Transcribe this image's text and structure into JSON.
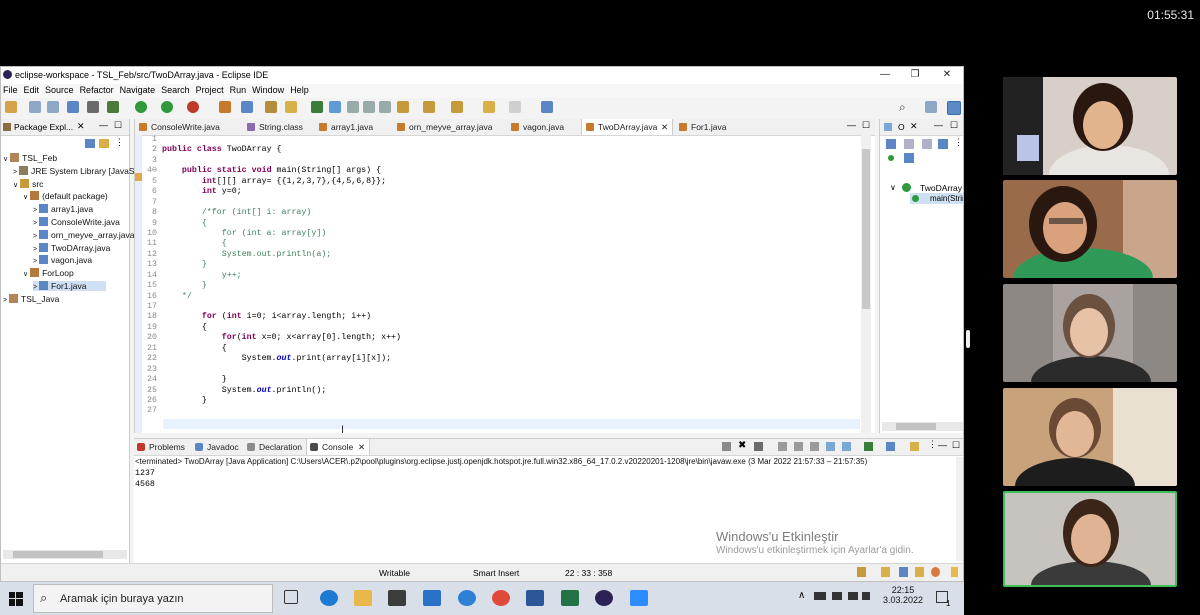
{
  "clock": "01:55:31",
  "window": {
    "title": "eclipse-workspace - TSL_Feb/src/TwoDArray.java - Eclipse IDE",
    "controls": [
      "—",
      "❐",
      "✕"
    ]
  },
  "menu": [
    "File",
    "Edit",
    "Source",
    "Refactor",
    "Navigate",
    "Search",
    "Project",
    "Run",
    "Window",
    "Help"
  ],
  "package_explorer": {
    "tab": "Package Expl...",
    "items": [
      {
        "label": "TSL_Feb",
        "indent": 0,
        "arrow": "∨",
        "icon": "project-icon"
      },
      {
        "label": "JRE System Library [JavaSE-17]",
        "indent": 1,
        "arrow": ">",
        "icon": "library-icon"
      },
      {
        "label": "src",
        "indent": 1,
        "arrow": "∨",
        "icon": "src-folder-icon"
      },
      {
        "label": "(default package)",
        "indent": 2,
        "arrow": "∨",
        "icon": "package-icon"
      },
      {
        "label": "array1.java",
        "indent": 3,
        "arrow": ">",
        "icon": "java-file-icon"
      },
      {
        "label": "ConsoleWrite.java",
        "indent": 3,
        "arrow": ">",
        "icon": "java-file-icon"
      },
      {
        "label": "orn_meyve_array.java",
        "indent": 3,
        "arrow": ">",
        "icon": "java-file-icon"
      },
      {
        "label": "TwoDArray.java",
        "indent": 3,
        "arrow": ">",
        "icon": "java-file-icon"
      },
      {
        "label": "vagon.java",
        "indent": 3,
        "arrow": ">",
        "icon": "java-file-icon"
      },
      {
        "label": "ForLoop",
        "indent": 2,
        "arrow": "∨",
        "icon": "package-icon"
      },
      {
        "label": "For1.java",
        "indent": 3,
        "arrow": ">",
        "icon": "java-file-icon",
        "selected": true
      },
      {
        "label": "TSL_Java",
        "indent": 0,
        "arrow": ">",
        "icon": "project-icon"
      }
    ]
  },
  "editor_tabs": [
    "ConsoleWrite.java",
    "String.class",
    "array1.java",
    "orn_meyve_array.java",
    "vagon.java",
    "TwoDArray.java",
    "For1.java"
  ],
  "active_tab": "TwoDArray.java",
  "line_numbers": [
    "1",
    "2",
    "3",
    "4⊖",
    "5",
    "6",
    "7",
    "8",
    "9",
    "10",
    "11",
    "12",
    "13",
    "14",
    "15",
    "16",
    "17",
    "18",
    "19",
    "20",
    "21",
    "22",
    "23",
    "24",
    "25",
    "26",
    "27"
  ],
  "code_lines": [
    [],
    [
      [
        "kw",
        "public class "
      ],
      [
        "",
        "TwoDArray {"
      ]
    ],
    [],
    [
      [
        "",
        "    "
      ],
      [
        "kw",
        "public static void "
      ],
      [
        "",
        "main(String[] args) {"
      ]
    ],
    [
      [
        "",
        "        "
      ],
      [
        "kw",
        "int"
      ],
      [
        "",
        "[][] array= {{1,2,3,7},{4,5,6,8}};"
      ]
    ],
    [
      [
        "",
        "        "
      ],
      [
        "kw",
        "int "
      ],
      [
        "",
        "y=0;"
      ]
    ],
    [],
    [
      [
        "cm",
        "        /*for (int[] i: array)"
      ]
    ],
    [
      [
        "cm",
        "        {"
      ]
    ],
    [
      [
        "cm",
        "            for (int a: array[y])"
      ]
    ],
    [
      [
        "cm",
        "            {"
      ]
    ],
    [
      [
        "cm",
        "            System.out.println(a);"
      ]
    ],
    [
      [
        "cm",
        "        }"
      ]
    ],
    [
      [
        "cm",
        "            y++;"
      ]
    ],
    [
      [
        "cm",
        "        }"
      ]
    ],
    [
      [
        "cm",
        "    */"
      ]
    ],
    [],
    [
      [
        "",
        "        "
      ],
      [
        "kw",
        "for "
      ],
      [
        "",
        "("
      ],
      [
        "kw",
        "int "
      ],
      [
        "",
        "i=0; i<array.length; i++)"
      ]
    ],
    [
      [
        "",
        "        {"
      ]
    ],
    [
      [
        "",
        "            "
      ],
      [
        "kw",
        "for"
      ],
      [
        "",
        "("
      ],
      [
        "kw",
        "int "
      ],
      [
        "",
        "x=0; x<array[0].length; x++)"
      ]
    ],
    [
      [
        "",
        "            {"
      ]
    ],
    [
      [
        "",
        "                System."
      ],
      [
        "fld",
        "out"
      ],
      [
        "",
        "."
      ],
      [
        "",
        "print"
      ],
      [
        "",
        "(array[i][x]);"
      ]
    ],
    [],
    [
      [
        "",
        "            }"
      ]
    ],
    [
      [
        "",
        "            System."
      ],
      [
        "fld",
        "out"
      ],
      [
        "",
        "."
      ],
      [
        "",
        "println();"
      ]
    ],
    [
      [
        "",
        "        }"
      ]
    ],
    []
  ],
  "outline": {
    "class": "TwoDArray",
    "method": "main(String[])"
  },
  "console": {
    "tabs": [
      "Problems",
      "Javadoc",
      "Declaration",
      "Console"
    ],
    "terminated": "<terminated> TwoDArray [Java Application] C:\\Users\\ACER\\.p2\\pool\\plugins\\org.eclipse.justj.openjdk.hotspot.jre.full.win32.x86_64_17.0.2.v20220201-1208\\jre\\bin\\javaw.exe (3 Mar 2022 21:57:33 – 21:57:35)",
    "output": [
      "1237",
      "4568"
    ]
  },
  "statusbar": {
    "writable": "Writable",
    "insert_mode": "Smart Insert",
    "position": "22 : 33 : 358"
  },
  "windows_activation": {
    "title": "Windows'u Etkinleştir",
    "subtitle": "Windows'u etkinleştirmek için Ayarlar'a gidin."
  },
  "taskbar": {
    "search_placeholder": "Aramak için buraya yazın",
    "time": "22:15",
    "date": "3.03.2022",
    "notification_count": "1"
  },
  "colors": {
    "keyword": "#7f0055",
    "comment": "#3f7f5f",
    "field": "#0000c0",
    "active_speaker_border": "#3cc05a"
  }
}
